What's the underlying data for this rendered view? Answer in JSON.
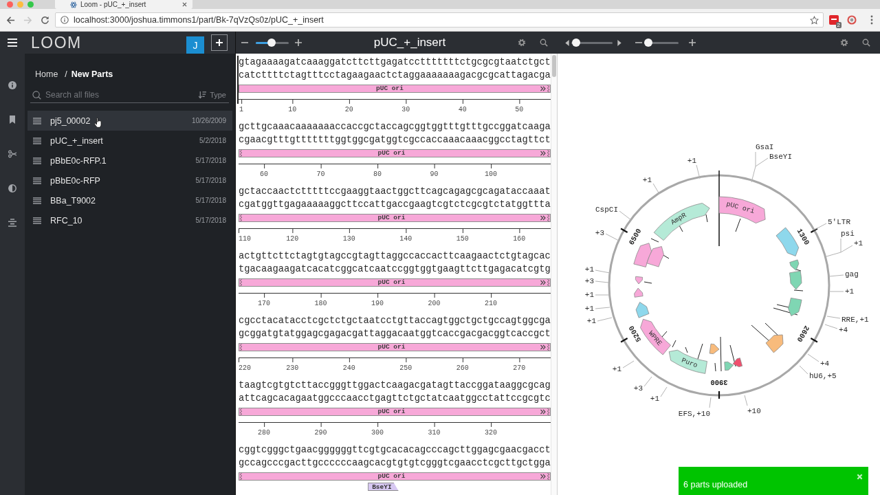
{
  "browser": {
    "tab": {
      "title": "Loom - pUC_+_insert"
    },
    "nav": {
      "forward_disabled": true
    },
    "url": "localhost:3000/joshua.timmons1/part/Bk-7qVzQs0z/pUC_+_insert",
    "extension_badge": "2"
  },
  "app_bar": {
    "logo": "LOOM",
    "user_initial": "J"
  },
  "breadcrumb": {
    "items": [
      {
        "label": "Home",
        "selected": false
      },
      {
        "label": "New Parts",
        "selected": true
      }
    ],
    "separator": "/"
  },
  "file_search": {
    "placeholder": "Search all files",
    "sort_label": "Type"
  },
  "files": [
    {
      "name": "pj5_00002",
      "date": "10/26/2009",
      "hovered": true
    },
    {
      "name": "pUC_+_insert",
      "date": "5/2/2018",
      "hovered": false
    },
    {
      "name": "pBbE0c-RFP.1",
      "date": "5/17/2018",
      "hovered": false
    },
    {
      "name": "pBbE0c-RFP",
      "date": "5/17/2018",
      "hovered": false
    },
    {
      "name": "BBa_T9002",
      "date": "5/17/2018",
      "hovered": false
    },
    {
      "name": "RFC_10",
      "date": "5/17/2018",
      "hovered": false
    }
  ],
  "sequence_viewer": {
    "title": "pUC_+_insert",
    "zoom": {
      "level": 0.48
    },
    "blocks": [
      {
        "top": "gtagaaaagatcaaaggatcttcttgagatcctttttttctgcgcgtaatctgct",
        "bottom": "catcttttctagtttcctagaagaactctaggaaaaaaagacgcgcattagacga",
        "cursor": true,
        "features": [
          {
            "label": "pUC ori",
            "color": "#f7a8d8",
            "forward": true,
            "continues_left": false,
            "continues_right": true
          }
        ],
        "ticks": [
          "1",
          "10",
          "20",
          "30",
          "40",
          "50"
        ]
      },
      {
        "top": "gcttgcaaacaaaaaaaccaccgctaccagcggtggtttgtttgccggatcaaga",
        "bottom": "cgaacgtttgtttttttggtggcgatggtcgccaccaaacaaacggcctagttct",
        "cursor": false,
        "features": [
          {
            "label": "pUC ori",
            "color": "#f7a8d8",
            "forward": true,
            "continues_left": true,
            "continues_right": true
          }
        ],
        "ticks": [
          "60",
          "70",
          "80",
          "90",
          "100"
        ]
      },
      {
        "top": "gctaccaactctttttccgaaggtaactggcttcagcagagcgcagataccaaat",
        "bottom": "cgatggttgagaaaaaggcttccattgaccgaagtcgtctcgcgtctatggttta",
        "cursor": false,
        "features": [
          {
            "label": "pUC ori",
            "color": "#f7a8d8",
            "forward": true,
            "continues_left": true,
            "continues_right": true
          }
        ],
        "ticks": [
          "110",
          "120",
          "130",
          "140",
          "150",
          "160"
        ]
      },
      {
        "top": "actgttcttctagtgtagccgtagttaggccaccacttcaagaactctgtagcac",
        "bottom": "tgacaagaagatcacatcggcatcaatccggtggtgaagttcttgagacatcgtg",
        "cursor": false,
        "features": [
          {
            "label": "pUC ori",
            "color": "#f7a8d8",
            "forward": true,
            "continues_left": true,
            "continues_right": true
          }
        ],
        "ticks": [
          "170",
          "180",
          "190",
          "200",
          "210"
        ]
      },
      {
        "top": "cgcctacatacctcgctctgctaatcctgttaccagtggctgctgccagtggcga",
        "bottom": "gcggatgtatggagcgagacgattaggacaatggtcaccgacgacggtcaccgct",
        "cursor": false,
        "features": [
          {
            "label": "pUC ori",
            "color": "#f7a8d8",
            "forward": true,
            "continues_left": true,
            "continues_right": true
          }
        ],
        "ticks": [
          "220",
          "230",
          "240",
          "250",
          "260",
          "270"
        ]
      },
      {
        "top": "taagtcgtgtcttaccgggttggactcaagacgatagttaccggataaggcgcag",
        "bottom": "attcagcacagaatggcccaacctgagttctgctatcaatggcctattccgcgtc",
        "cursor": false,
        "features": [
          {
            "label": "pUC ori",
            "color": "#f7a8d8",
            "forward": true,
            "continues_left": true,
            "continues_right": true
          }
        ],
        "ticks": [
          "280",
          "290",
          "300",
          "310",
          "320"
        ]
      },
      {
        "top": "cggtcgggctgaacggggggttcgtgcacacagcccagcttggagcgaacgacct",
        "bottom": "gccagcccgacttgccccccaagcacgtgtgtcgggtcgaacctcgcttgctgga",
        "cursor": false,
        "features": [
          {
            "label": "pUC ori",
            "color": "#f7a8d8",
            "forward": true,
            "continues_left": true,
            "continues_right": true
          }
        ],
        "cut_sites": [
          {
            "label": "BseYI"
          }
        ]
      }
    ]
  },
  "map_viewer": {
    "rotation": {
      "level": 0.12
    },
    "zoom": {
      "level": 0.12
    },
    "position_labels": [
      "1300",
      "2600",
      "3900",
      "5200",
      "6500"
    ],
    "features": [
      {
        "label": "pUC ori",
        "color": "#f7a8d8"
      },
      {
        "color": "#8ed8ec"
      },
      {
        "color": "#7fd6b3"
      },
      {
        "color": "#7fd6b3"
      },
      {
        "color": "#7fd6b3"
      },
      {
        "color": "#f8bb7c"
      },
      {
        "color": "#f0506e"
      },
      {
        "color": "#7fd6b3"
      },
      {
        "color": "#f8bb7c"
      },
      {
        "label": "Puro",
        "color": "#b5ead7"
      },
      {
        "label": "WPRE",
        "color": "#f7a8d8"
      },
      {
        "color": "#8ed8ec"
      },
      {
        "color": "#f7a8d8"
      },
      {
        "color": "#f7a8d8"
      },
      {
        "color": "#f7a8d8"
      },
      {
        "color": "#f7a8d8"
      },
      {
        "label": "AmpR",
        "color": "#b5ead7"
      }
    ],
    "site_labels": [
      "GsaI",
      "BseYI",
      "+1",
      "+1",
      "CspCI",
      "5'LTR",
      "+3",
      "psi",
      "+1",
      "+1",
      "gag",
      "+3",
      "+1",
      "+1",
      "+1",
      "+1",
      "RRE,+1",
      "+4",
      "+4",
      "+1",
      "hU6,+5",
      "+3",
      "+1",
      "EFS,+10",
      "+10"
    ]
  },
  "toast": {
    "message": "6 parts uploaded"
  }
}
